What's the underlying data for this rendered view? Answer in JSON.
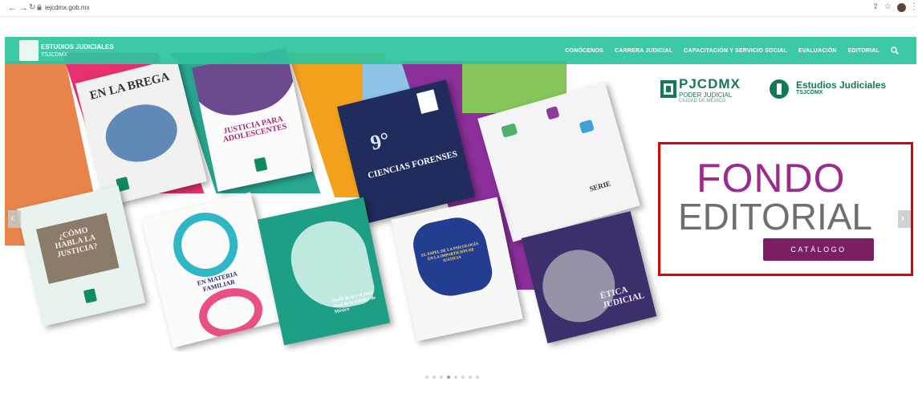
{
  "browser": {
    "url": "iejcdmx.gob.mx"
  },
  "header": {
    "logo_title": "ESTUDIOS JUDICIALES",
    "logo_subtitle": "TSJCDMX",
    "menu": [
      {
        "label": "CONÓCENOS"
      },
      {
        "label": "CARRERA JUDICIAL"
      },
      {
        "label": "CAPACITACIÓN Y SERVICIO SOCIAL"
      },
      {
        "label": "EVALUACIÓN"
      },
      {
        "label": "EDITORIAL"
      }
    ]
  },
  "hero": {
    "brand_pj_title": "PJCDMX",
    "brand_pj_sub1": "PODER JUDICIAL",
    "brand_pj_sub2": "CIUDAD DE MÉXICO",
    "brand_ej_title": "Estudios Judiciales",
    "brand_ej_sub": "TSJCDMX",
    "headline_1": "FONDO",
    "headline_2": "EDITORIAL",
    "cta_label": "CATÁLOGO",
    "books": [
      {
        "title": "EN LA BREGA"
      },
      {
        "title": "JUSTICIA PARA ADOLESCENTES"
      },
      {
        "title": "9°",
        "subtitle": "CIENCIAS FORENSES"
      },
      {
        "title": "SERIE"
      },
      {
        "title": "¿CÓMO HABLA LA JUSTICIA?"
      },
      {
        "title": "EN MATERIA FAMILIAR"
      },
      {
        "title": "Perfil de la y el Juez Oral de la Ciudad de México"
      },
      {
        "title": "EL PAPEL DE LA PSICOLOGÍA EN LA IMPARTICIÓN DE JUSTICIA"
      },
      {
        "title": "ÉTICA JUDICIAL"
      }
    ],
    "slide_count": 8,
    "active_slide": 4
  },
  "colors": {
    "header": "#2ec49e",
    "headline_purple": "#9b2c8e",
    "headline_gray": "#6f6f6f",
    "cta": "#7a1f63",
    "highlight": "#e00000"
  }
}
